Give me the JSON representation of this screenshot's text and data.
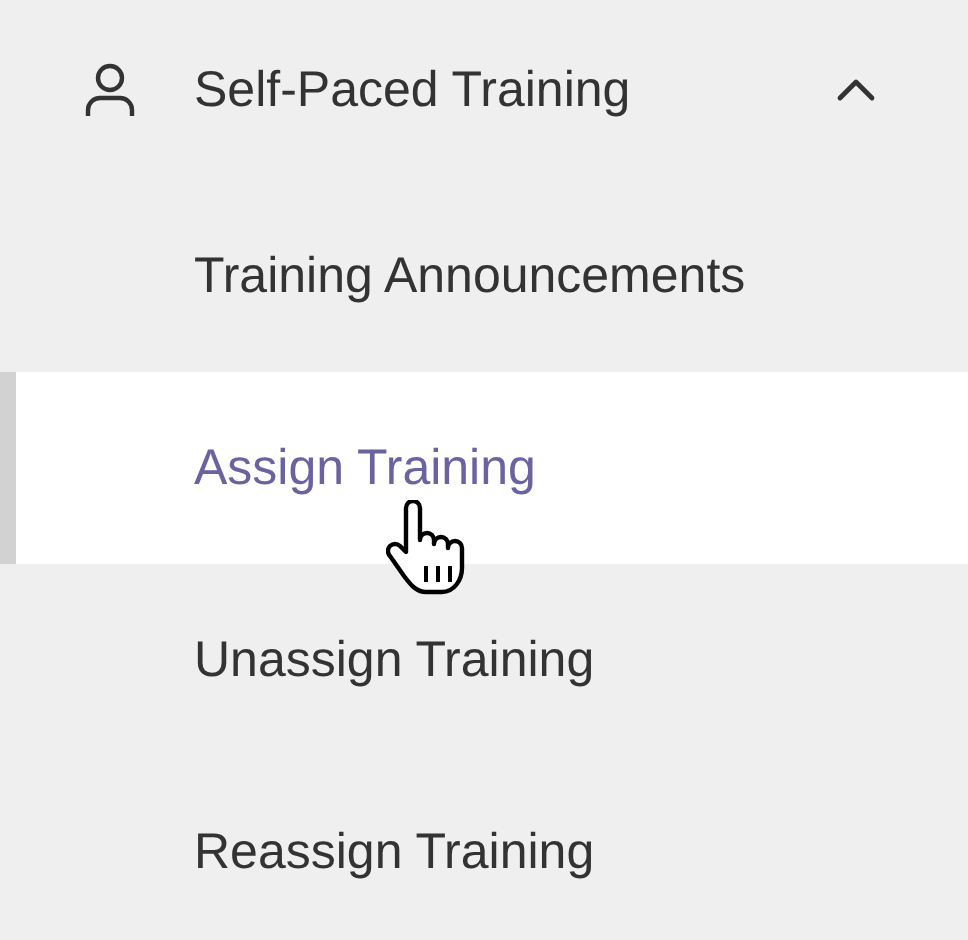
{
  "section": {
    "title": "Self-Paced Training",
    "expanded": true
  },
  "items": [
    {
      "label": "Training Announcements",
      "selected": false
    },
    {
      "label": "Assign Training",
      "selected": true
    },
    {
      "label": "Unassign Training",
      "selected": false
    },
    {
      "label": "Reassign Training",
      "selected": false
    }
  ]
}
